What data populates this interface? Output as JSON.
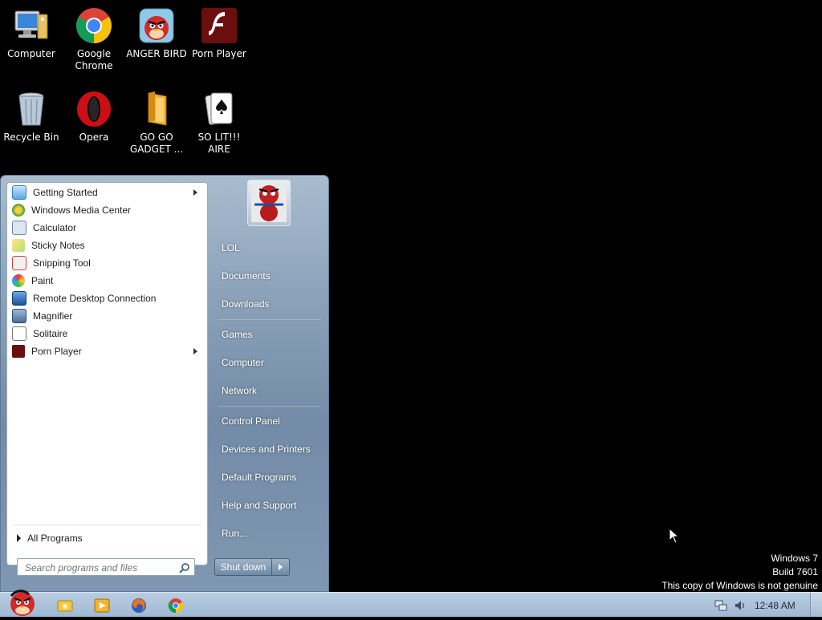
{
  "desktop_icons": [
    {
      "id": "computer",
      "label": "Computer",
      "icon": "computer-icon"
    },
    {
      "id": "chrome",
      "label": "Google Chrome",
      "icon": "chrome-icon"
    },
    {
      "id": "angerbird",
      "label": "ANGER BIRD",
      "icon": "angry-bird-icon"
    },
    {
      "id": "pornplayer",
      "label": "Porn Player",
      "icon": "flash-player-icon"
    },
    {
      "id": "recyclebin",
      "label": "Recycle Bin",
      "icon": "recycle-bin-icon"
    },
    {
      "id": "opera",
      "label": "Opera",
      "icon": "opera-icon"
    },
    {
      "id": "gogogadget",
      "label": "GO GO GADGET ...",
      "icon": "folder-icon"
    },
    {
      "id": "solitaire",
      "label": "SO LIT!!! AIRE",
      "icon": "solitaire-cards-icon"
    }
  ],
  "start_menu": {
    "programs": [
      {
        "label": "Getting Started",
        "icon": "getting-started-icon",
        "submenu": true
      },
      {
        "label": "Windows Media Center",
        "icon": "media-center-icon",
        "submenu": false
      },
      {
        "label": "Calculator",
        "icon": "calculator-icon",
        "submenu": false
      },
      {
        "label": "Sticky Notes",
        "icon": "sticky-notes-icon",
        "submenu": false
      },
      {
        "label": "Snipping Tool",
        "icon": "snipping-tool-icon",
        "submenu": false
      },
      {
        "label": "Paint",
        "icon": "paint-icon",
        "submenu": false
      },
      {
        "label": "Remote Desktop Connection",
        "icon": "remote-desktop-icon",
        "submenu": false
      },
      {
        "label": "Magnifier",
        "icon": "magnifier-icon",
        "submenu": false
      },
      {
        "label": "Solitaire",
        "icon": "solitaire-icon",
        "submenu": false
      },
      {
        "label": "Porn Player",
        "icon": "flash-player-icon",
        "submenu": true
      }
    ],
    "all_programs": "All Programs",
    "search_placeholder": "Search programs and files",
    "right_items": [
      {
        "label": "LOL"
      },
      {
        "label": "Documents"
      },
      {
        "label": "Downloads"
      },
      {
        "label": "Games"
      },
      {
        "label": "Computer"
      },
      {
        "label": "Network"
      },
      {
        "label": "Control Panel"
      },
      {
        "label": "Devices and Printers"
      },
      {
        "label": "Default Programs"
      },
      {
        "label": "Help and Support"
      },
      {
        "label": "Run..."
      }
    ],
    "shutdown_label": "Shut down"
  },
  "watermark": {
    "line1": "Windows 7",
    "line2": "Build 7601",
    "line3": "This copy of Windows is not genuine"
  },
  "taskbar": {
    "pinned": [
      "explorer-icon",
      "media-player-icon",
      "firefox-icon",
      "chrome-icon"
    ],
    "clock": "12:48 AM"
  },
  "colors": {
    "desktop_bg": "#000000",
    "start_menu_accent": "#7f97b1",
    "taskbar_bg": "#a9c0d8"
  }
}
